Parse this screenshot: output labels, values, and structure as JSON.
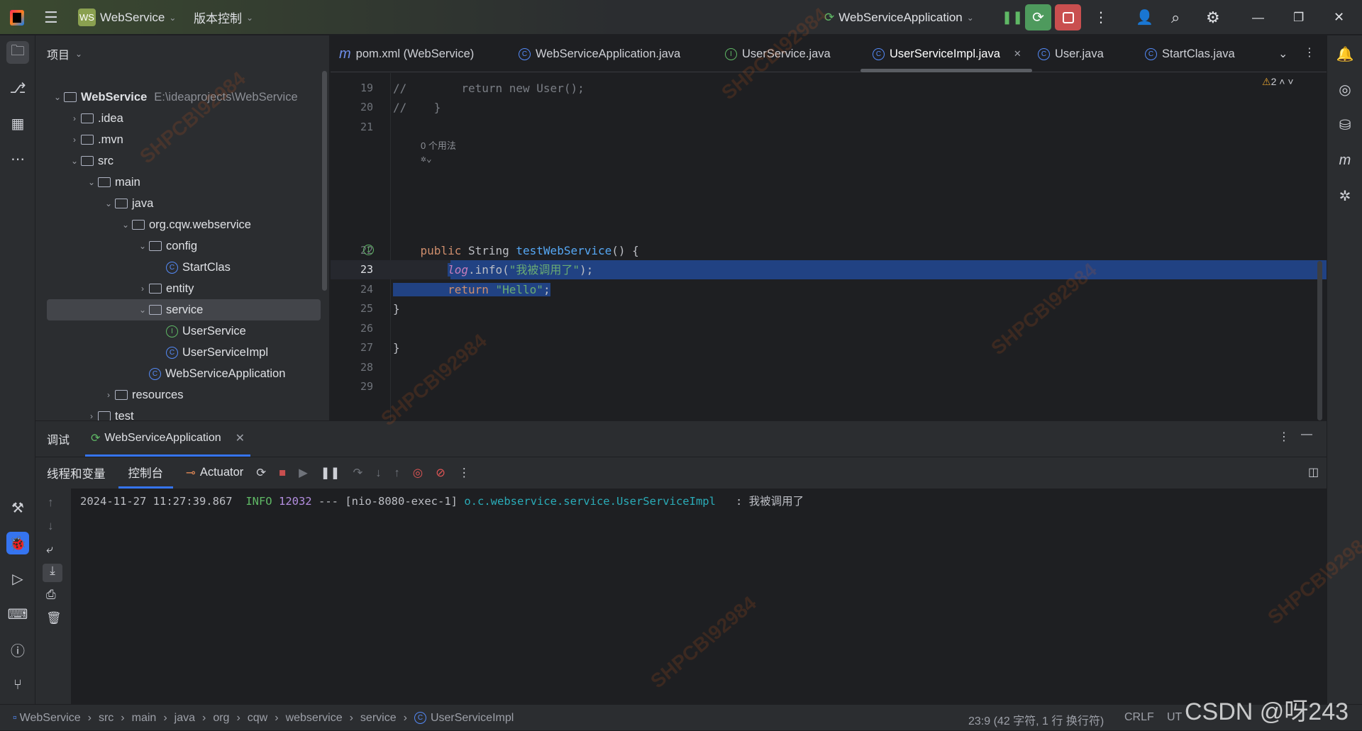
{
  "titlebar": {
    "project_badge": "WS",
    "project": "WebService",
    "vcs": "版本控制",
    "run_config": "WebServiceApplication"
  },
  "project_panel": {
    "title": "项目",
    "tree": [
      {
        "label": "WebService",
        "path": "E:\\ideaprojects\\WebService",
        "level": 0,
        "arrow": "down",
        "icon": "module-folder-icon"
      },
      {
        "label": ".idea",
        "level": 1,
        "arrow": "right",
        "icon": "folder-icon"
      },
      {
        "label": ".mvn",
        "level": 1,
        "arrow": "right",
        "icon": "folder-icon"
      },
      {
        "label": "src",
        "level": 1,
        "arrow": "down",
        "icon": "folder-icon"
      },
      {
        "label": "main",
        "level": 2,
        "arrow": "down",
        "icon": "folder-icon"
      },
      {
        "label": "java",
        "level": 3,
        "arrow": "down",
        "icon": "source-folder-icon"
      },
      {
        "label": "org.cqw.webservice",
        "level": 4,
        "arrow": "down",
        "icon": "package-icon"
      },
      {
        "label": "config",
        "level": 5,
        "arrow": "down",
        "icon": "package-icon"
      },
      {
        "label": "StartClas",
        "level": 6,
        "arrow": "",
        "icon": "class-icon"
      },
      {
        "label": "entity",
        "level": 5,
        "arrow": "right",
        "icon": "package-icon"
      },
      {
        "label": "service",
        "level": 5,
        "arrow": "down",
        "icon": "package-icon",
        "selected": true
      },
      {
        "label": "UserService",
        "level": 6,
        "arrow": "",
        "icon": "interface-icon"
      },
      {
        "label": "UserServiceImpl",
        "level": 6,
        "arrow": "",
        "icon": "class-icon"
      },
      {
        "label": "WebServiceApplication",
        "level": 5,
        "arrow": "",
        "icon": "spring-boot-class-icon"
      },
      {
        "label": "resources",
        "level": 3,
        "arrow": "right",
        "icon": "resources-folder-icon"
      },
      {
        "label": "test",
        "level": 2,
        "arrow": "right",
        "icon": "folder-icon"
      }
    ]
  },
  "tabs": [
    {
      "label": "pom.xml (WebService)",
      "icon": "maven-icon"
    },
    {
      "label": "WebServiceApplication.java",
      "icon": "spring-boot-class-icon"
    },
    {
      "label": "UserService.java",
      "icon": "interface-icon"
    },
    {
      "label": "UserServiceImpl.java",
      "icon": "class-icon",
      "active": true
    },
    {
      "label": "User.java",
      "icon": "class-icon"
    },
    {
      "label": "StartClas.java",
      "icon": "class-icon"
    }
  ],
  "editor": {
    "warnings": "2",
    "usages_hint": "0 个用法",
    "lines": {
      "19": "//        return new User();",
      "20": "//    }",
      "21": "",
      "22": "public String testWebService() {",
      "23": "log.info(\"我被调用了\");",
      "24": "return \"Hello\";",
      "25": "}",
      "26": "",
      "27": "}",
      "28": "",
      "29": ""
    }
  },
  "debug_panel": {
    "title": "调试",
    "session": "WebServiceApplication",
    "subtabs": [
      "线程和变量",
      "控制台",
      "Actuator"
    ],
    "active_subtab": "控制台",
    "console": {
      "timestamp": "2024-11-27 11:27:39.867",
      "level": "INFO",
      "pid": "12032",
      "sep": "---",
      "thread": "[nio-8080-exec-1]",
      "logger": "o.c.webservice.service.UserServiceImpl",
      "message": ": 我被调用了"
    }
  },
  "status": {
    "breadcrumb": [
      "WebService",
      "src",
      "main",
      "java",
      "org",
      "cqw",
      "webservice",
      "service",
      "UserServiceImpl"
    ],
    "position": "23:9 (42 字符, 1 行 换行符)",
    "line_sep": "CRLF",
    "encoding": "UT"
  },
  "watermark": "CSDN @呀243",
  "colors": {
    "accent": "#3574f0",
    "selection": "#214283",
    "run_green": "#4e9a5d",
    "stop_red": "#c94f4f"
  }
}
